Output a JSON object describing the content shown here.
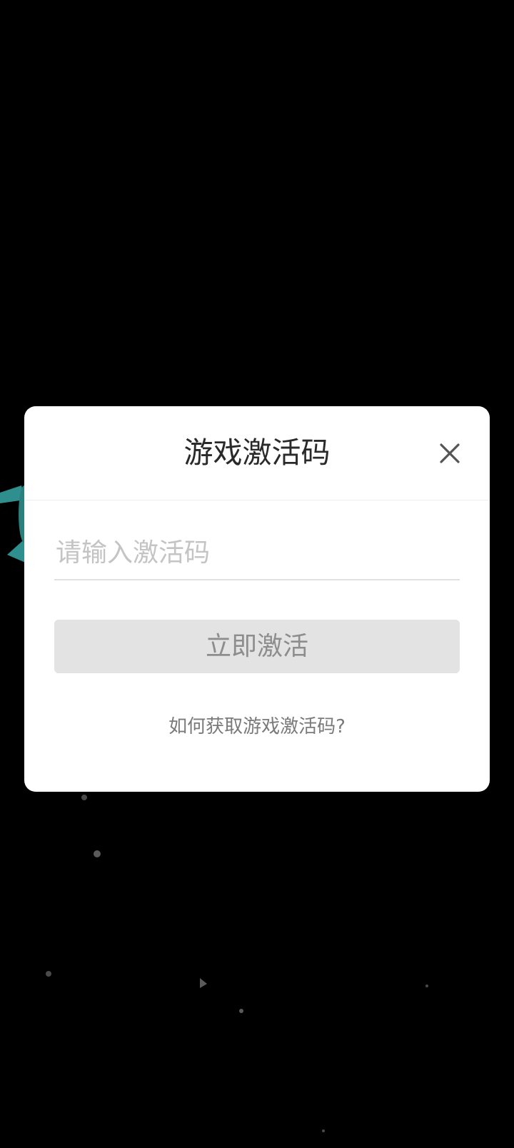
{
  "dialog": {
    "title": "游戏激活码",
    "close_icon": "close-icon",
    "input": {
      "value": "",
      "placeholder": "请输入激活码"
    },
    "activate_button_label": "立即激活",
    "help_link": "如何获取游戏激活码?"
  },
  "colors": {
    "background": "#000000",
    "dialog_background": "#ffffff",
    "button_disabled_bg": "#e3e3e3",
    "button_disabled_text": "#8d8d8d",
    "accent_teal": "#3fa6a6"
  }
}
